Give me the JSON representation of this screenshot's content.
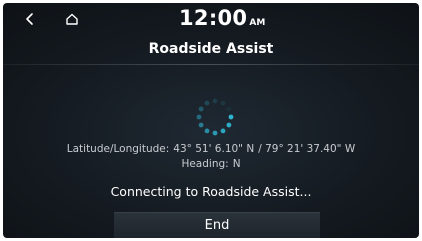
{
  "header": {
    "time": "12:00",
    "ampm": "AM",
    "back_icon": "chevron-left-icon",
    "home_icon": "home-icon"
  },
  "title": "Roadside Assist",
  "location": {
    "label": "Latitude/Longitude:",
    "latitude": "43° 51' 6.10\" N",
    "longitude": "/ 79° 21' 37.40\" W",
    "heading_label": "Heading:",
    "heading_value": "N"
  },
  "status_text": "Connecting to Roadside Assist...",
  "end_button": "End",
  "colors": {
    "accent": "#2fb3d0",
    "text": "#ffffff",
    "secondary_text": "#c9ccd0"
  }
}
